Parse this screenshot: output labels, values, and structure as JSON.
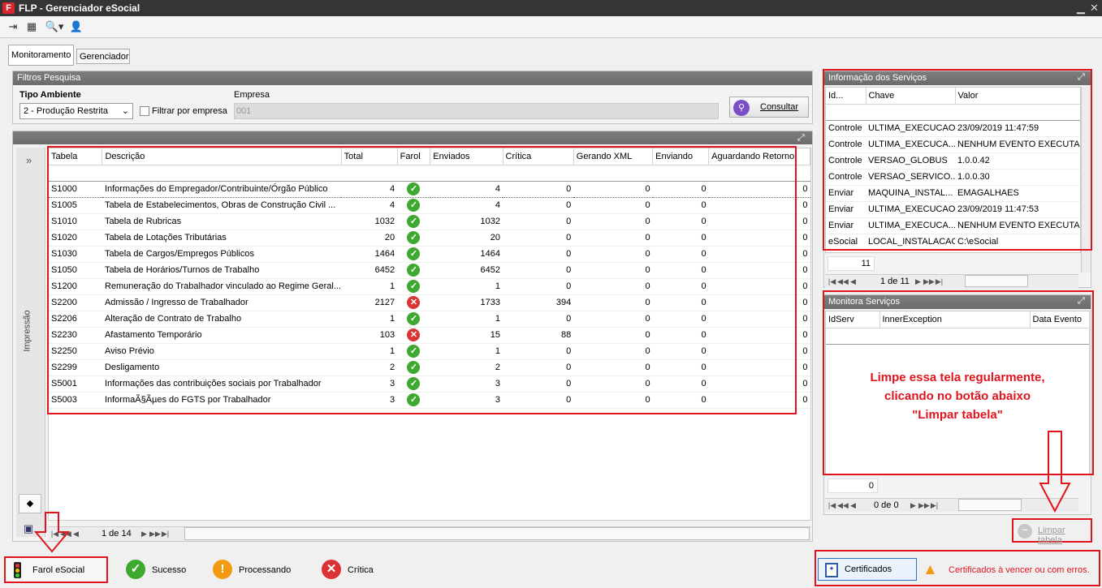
{
  "window": {
    "title": "FLP - Gerenciador eSocial",
    "logo": "F"
  },
  "tabs": [
    "Monitoramento",
    "Gerenciador"
  ],
  "filters": {
    "header": "Filtros Pesquisa",
    "ambiente_label": "Tipo Ambiente",
    "ambiente_value": "2 - Produção Restrita",
    "filtrar_label": "Filtrar por empresa",
    "empresa_label": "Empresa",
    "empresa_value": "001",
    "consultar": "Consultar"
  },
  "side": {
    "label": "Impressão",
    "expand": "»"
  },
  "main_table": {
    "columns": [
      "Tabela",
      "Descrição",
      "Total",
      "Farol",
      "Enviados",
      "Crítica",
      "Gerando XML",
      "Enviando",
      "Aguardando Retorno"
    ],
    "rows": [
      [
        "S1000",
        "Informações do Empregador/Contribuinte/Órgão Público",
        "4",
        "ok",
        "4",
        "0",
        "0",
        "0",
        "0"
      ],
      [
        "S1005",
        "Tabela de Estabelecimentos, Obras de Construção Civil ...",
        "4",
        "ok",
        "4",
        "0",
        "0",
        "0",
        "0"
      ],
      [
        "S1010",
        "Tabela de Rubricas",
        "1032",
        "ok",
        "1032",
        "0",
        "0",
        "0",
        "0"
      ],
      [
        "S1020",
        "Tabela de Lotações Tributárias",
        "20",
        "ok",
        "20",
        "0",
        "0",
        "0",
        "0"
      ],
      [
        "S1030",
        "Tabela de Cargos/Empregos Públicos",
        "1464",
        "ok",
        "1464",
        "0",
        "0",
        "0",
        "0"
      ],
      [
        "S1050",
        "Tabela de Horários/Turnos de Trabalho",
        "6452",
        "ok",
        "6452",
        "0",
        "0",
        "0",
        "0"
      ],
      [
        "S1200",
        "Remuneração do Trabalhador vinculado ao Regime Geral...",
        "1",
        "ok",
        "1",
        "0",
        "0",
        "0",
        "0"
      ],
      [
        "S2200",
        "Admissão / Ingresso de Trabalhador",
        "2127",
        "err",
        "1733",
        "394",
        "0",
        "0",
        "0"
      ],
      [
        "S2206",
        "Alteração de Contrato de Trabalho",
        "1",
        "ok",
        "1",
        "0",
        "0",
        "0",
        "0"
      ],
      [
        "S2230",
        "Afastamento Temporário",
        "103",
        "err",
        "15",
        "88",
        "0",
        "0",
        "0"
      ],
      [
        "S2250",
        "Aviso Prévio",
        "1",
        "ok",
        "1",
        "0",
        "0",
        "0",
        "0"
      ],
      [
        "S2299",
        "Desligamento",
        "2",
        "ok",
        "2",
        "0",
        "0",
        "0",
        "0"
      ],
      [
        "S5001",
        "Informações das contribuições sociais por Trabalhador",
        "3",
        "ok",
        "3",
        "0",
        "0",
        "0",
        "0"
      ],
      [
        "S5003",
        "InformaÃ§Ãµes do FGTS por Trabalhador",
        "3",
        "ok",
        "3",
        "0",
        "0",
        "0",
        "0"
      ]
    ],
    "pager": "1 de 14"
  },
  "info_servicos": {
    "header": "Informação dos Serviços",
    "columns": [
      "Id...",
      "Chave",
      "Valor"
    ],
    "rows": [
      [
        "Controle",
        "ULTIMA_EXECUCAO",
        "23/09/2019 11:47:59"
      ],
      [
        "Controle",
        "ULTIMA_EXECUCA...",
        "NENHUM EVENTO EXECUTANDO"
      ],
      [
        "Controle",
        "VERSAO_GLOBUS",
        "1.0.0.42"
      ],
      [
        "Controle",
        "VERSAO_SERVICO...",
        "1.0.0.30"
      ],
      [
        "Enviar",
        "MAQUINA_INSTAL...",
        "EMAGALHAES"
      ],
      [
        "Enviar",
        "ULTIMA_EXECUCAO",
        "23/09/2019 11:47:53"
      ],
      [
        "Enviar",
        "ULTIMA_EXECUCA...",
        "NENHUM EVENTO EXECUTANDO"
      ],
      [
        "eSocial",
        "LOCAL_INSTALACAO",
        "C:\\eSocial"
      ]
    ],
    "count": "11",
    "pager": "1 de 11"
  },
  "monitora": {
    "header": "Monitora Serviços",
    "columns": [
      "IdServ",
      "InnerException",
      "Data Evento"
    ],
    "note_line1": "Limpe essa tela regularmente,",
    "note_line2": "clicando no botão abaixo",
    "note_line3": "\"Limpar tabela\"",
    "count": "0",
    "pager": "0 de 0",
    "limpar": "Limpar tabela"
  },
  "legend": {
    "farol": "Farol eSocial",
    "sucesso": "Sucesso",
    "processando": "Processando",
    "critica": "Crítica"
  },
  "cert": {
    "button": "Certificados",
    "warning": "Certificados à vencer ou com erros."
  },
  "colors": {
    "accent_red": "#e0141e",
    "ok": "#3da92e",
    "err": "#db3333",
    "warn": "#f29b11"
  }
}
